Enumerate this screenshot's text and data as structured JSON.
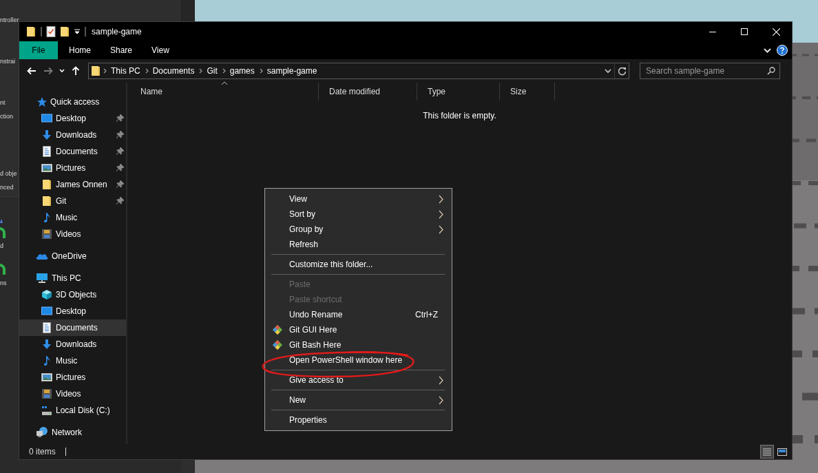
{
  "background_app": {
    "texts": [
      "ntroller",
      "nstrai",
      "nt",
      "ction",
      "d obje",
      "nced",
      "d",
      "ns"
    ]
  },
  "window": {
    "title": "sample-game"
  },
  "ribbon": {
    "file_button": "File",
    "tabs": [
      "Home",
      "Share",
      "View"
    ]
  },
  "nav_buttons": [
    {
      "kind": "back",
      "disabled": false
    },
    {
      "kind": "forward",
      "disabled": true
    },
    {
      "kind": "recent",
      "disabled": false
    },
    {
      "kind": "up",
      "disabled": false
    }
  ],
  "address": {
    "crumbs": [
      "This PC",
      "Documents",
      "Git",
      "games",
      "sample-game"
    ]
  },
  "search": {
    "placeholder": "Search sample-game"
  },
  "sidebar": {
    "items": [
      {
        "label": "Quick access",
        "kind": "star",
        "selected": false,
        "children": [
          {
            "label": "Desktop",
            "kind": "desktop",
            "pinned": true,
            "selected": false
          },
          {
            "label": "Downloads",
            "kind": "downloads",
            "pinned": true,
            "selected": false
          },
          {
            "label": "Documents",
            "kind": "documents",
            "pinned": true,
            "selected": false
          },
          {
            "label": "Pictures",
            "kind": "pictures",
            "pinned": true,
            "selected": false
          },
          {
            "label": "James Onnen",
            "kind": "folder",
            "pinned": true,
            "selected": false
          },
          {
            "label": "Git",
            "kind": "folder",
            "pinned": true,
            "selected": false
          },
          {
            "label": "Music",
            "kind": "music",
            "pinned": false,
            "selected": false
          },
          {
            "label": "Videos",
            "kind": "videos",
            "pinned": false,
            "selected": false
          }
        ]
      },
      {
        "label": "OneDrive",
        "kind": "cloud",
        "selected": false
      },
      {
        "label": "This PC",
        "kind": "pc",
        "selected": false,
        "children": [
          {
            "label": "3D Objects",
            "kind": "cube",
            "pinned": false,
            "selected": false
          },
          {
            "label": "Desktop",
            "kind": "desktop",
            "pinned": false,
            "selected": false
          },
          {
            "label": "Documents",
            "kind": "documents",
            "pinned": false,
            "selected": true
          },
          {
            "label": "Downloads",
            "kind": "downloads",
            "pinned": false,
            "selected": false
          },
          {
            "label": "Music",
            "kind": "music",
            "pinned": false,
            "selected": false
          },
          {
            "label": "Pictures",
            "kind": "pictures",
            "pinned": false,
            "selected": false
          },
          {
            "label": "Videos",
            "kind": "videos",
            "pinned": false,
            "selected": false
          },
          {
            "label": "Local Disk (C:)",
            "kind": "disk",
            "pinned": false,
            "selected": false
          }
        ]
      },
      {
        "label": "Network",
        "kind": "network",
        "selected": false
      }
    ]
  },
  "columns": [
    {
      "label": "Name",
      "sorted": true
    },
    {
      "label": "Date modified",
      "sorted": false
    },
    {
      "label": "Type",
      "sorted": false
    },
    {
      "label": "Size",
      "sorted": false
    }
  ],
  "empty_message": "This folder is empty.",
  "context_menu": {
    "items": [
      {
        "kind": "command",
        "label": "View",
        "submenu": true,
        "disabled": false
      },
      {
        "kind": "command",
        "label": "Sort by",
        "submenu": true,
        "disabled": false
      },
      {
        "kind": "command",
        "label": "Group by",
        "submenu": true,
        "disabled": false
      },
      {
        "kind": "command",
        "label": "Refresh",
        "submenu": false,
        "disabled": false
      },
      {
        "kind": "separator"
      },
      {
        "kind": "command",
        "label": "Customize this folder...",
        "submenu": false,
        "disabled": false
      },
      {
        "kind": "separator"
      },
      {
        "kind": "command",
        "label": "Paste",
        "submenu": false,
        "disabled": true
      },
      {
        "kind": "command",
        "label": "Paste shortcut",
        "submenu": false,
        "disabled": true
      },
      {
        "kind": "command",
        "label": "Undo Rename",
        "shortcut": "Ctrl+Z",
        "submenu": false,
        "disabled": false
      },
      {
        "kind": "git",
        "label": "Git GUI Here",
        "submenu": false,
        "disabled": false
      },
      {
        "kind": "git",
        "label": "Git Bash Here",
        "submenu": false,
        "disabled": false
      },
      {
        "kind": "command",
        "label": "Open PowerShell window here",
        "submenu": false,
        "disabled": false
      },
      {
        "kind": "separator"
      },
      {
        "kind": "command",
        "label": "Give access to",
        "submenu": true,
        "disabled": false
      },
      {
        "kind": "separator"
      },
      {
        "kind": "command",
        "label": "New",
        "submenu": true,
        "disabled": false
      },
      {
        "kind": "separator"
      },
      {
        "kind": "command",
        "label": "Properties",
        "submenu": false,
        "disabled": false
      }
    ]
  },
  "status_bar": {
    "item_count": "0 items"
  },
  "view_buttons": [
    {
      "kind": "details",
      "selected": true
    },
    {
      "kind": "large-icons",
      "selected": false
    }
  ]
}
